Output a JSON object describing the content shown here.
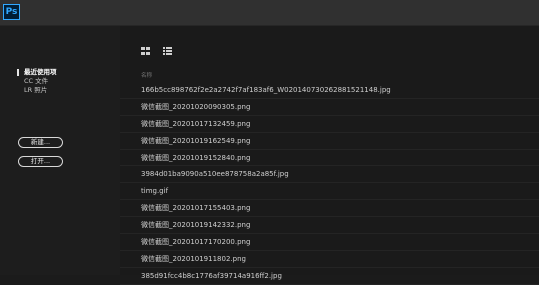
{
  "app": {
    "logo_text": "Ps",
    "accent": "#31a8ff"
  },
  "sidebar": {
    "items": [
      {
        "label": "最近使用项",
        "active": true
      },
      {
        "label": "CC 文件",
        "active": false
      },
      {
        "label": "LR 照片",
        "active": false
      }
    ],
    "new_button": "新建...",
    "open_button": "打开..."
  },
  "main": {
    "view_icons": [
      "grid-view-icon",
      "list-view-icon"
    ],
    "column_header": "名称",
    "files": [
      "166b5cc898762f2e2a2742f7af183af6_W020140730262881521148.jpg",
      "微信截图_20201020090305.png",
      "微信截图_20201017132459.png",
      "微信截图_20201019162549.png",
      "微信截图_20201019152840.png",
      "3984d01ba9090a510ee878758a2a85f.jpg",
      "timg.gif",
      "微信截图_20201017155403.png",
      "微信截图_20201019142332.png",
      "微信截图_20201017170200.png",
      "微信截图_2020101911802.png",
      "385d91fcc4b8c1776af39714a916ff2.jpg"
    ]
  }
}
